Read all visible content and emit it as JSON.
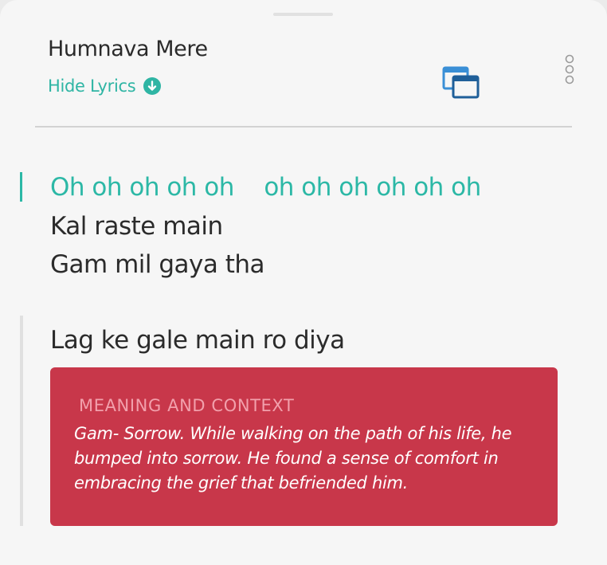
{
  "header": {
    "song_title": "Humnava Mere",
    "hide_lyrics_label": "Hide Lyrics",
    "hide_lyrics_icon": "arrow-down-circle-icon",
    "window_icon": "picture-in-picture-icon",
    "more_icon": "more-vertical-icon"
  },
  "lyrics": {
    "lines": [
      {
        "text": "Oh oh oh oh oh    oh oh oh oh oh oh",
        "state": "active"
      },
      {
        "text": "Kal raste main",
        "state": "normal"
      },
      {
        "text": "Gam mil gaya tha",
        "state": "normal"
      },
      {
        "text": "Lag ke gale main ro diya",
        "state": "annotated"
      }
    ]
  },
  "meaning": {
    "heading": "MEANING AND CONTEXT",
    "body": "Gam- Sorrow. While walking on the path of his life, he bumped into sorrow. He found a sense of comfort in embracing the grief that befriended him."
  },
  "colors": {
    "accent": "#2cb8a6",
    "card": "#c8374a",
    "card_heading": "#f2a0ac",
    "window_icon": "#3a8fd6"
  }
}
